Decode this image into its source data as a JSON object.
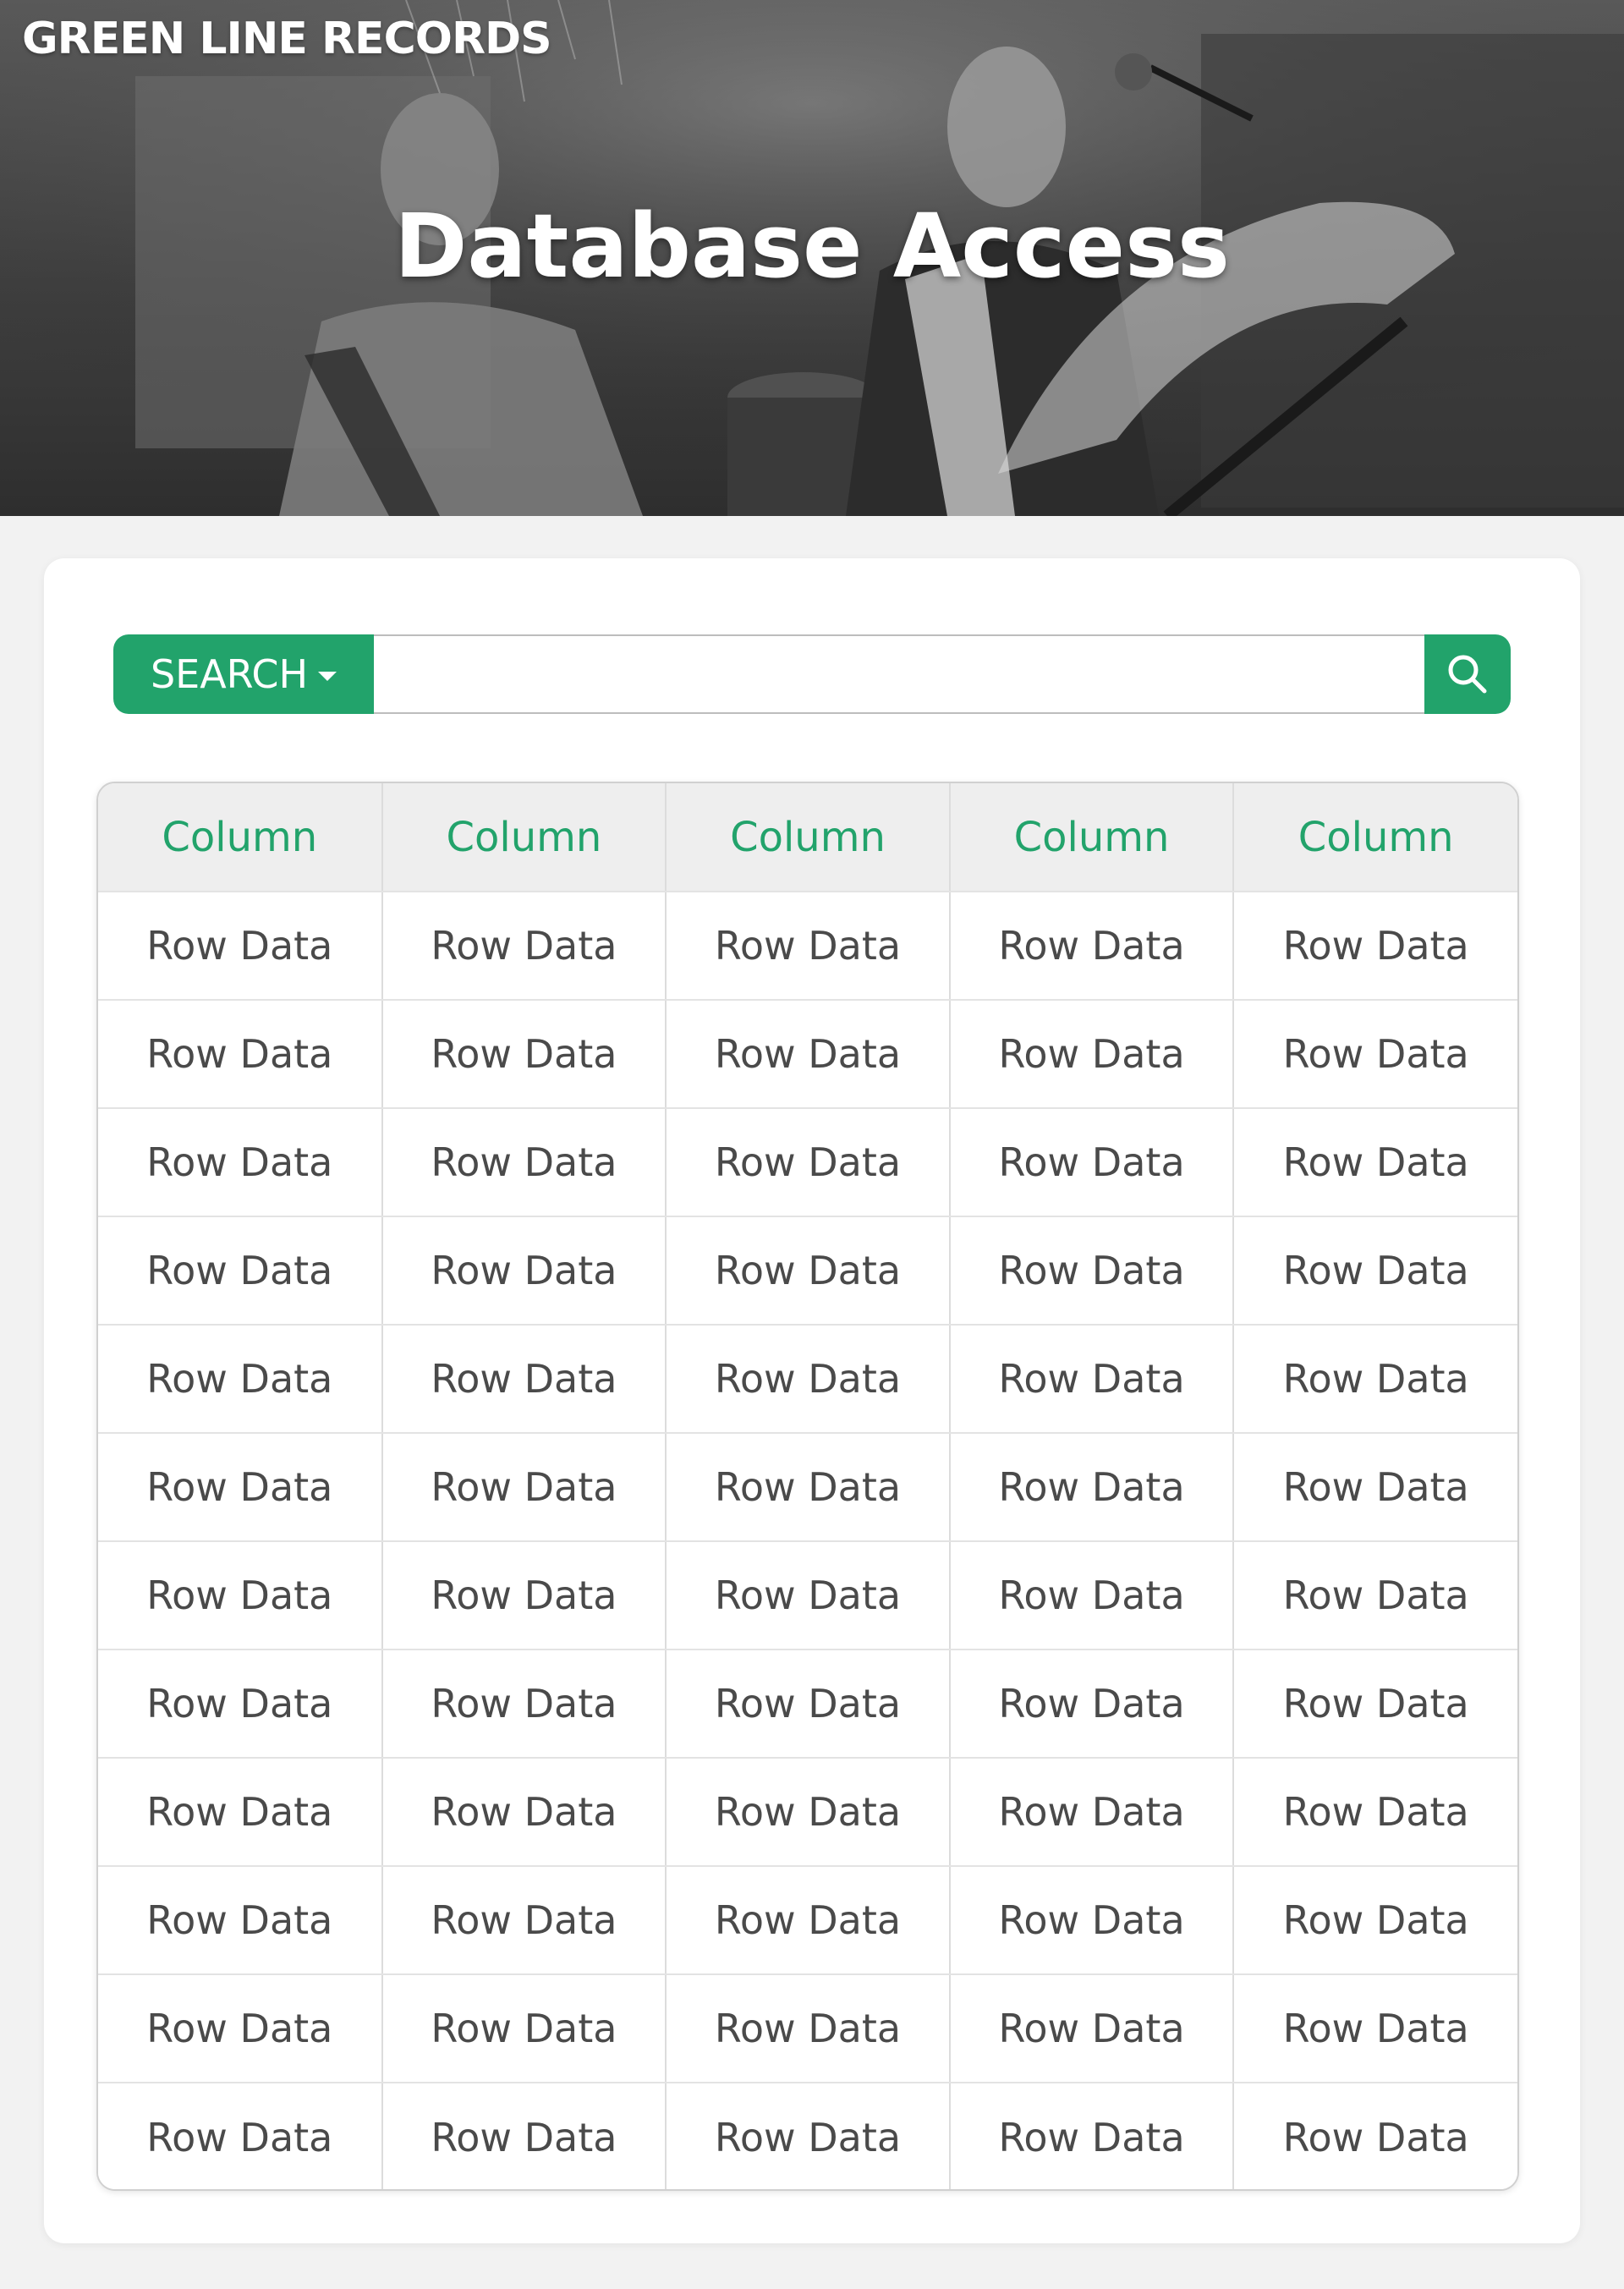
{
  "brand": {
    "name": "GREEN LINE RECORDS"
  },
  "hero": {
    "title": "Database Access"
  },
  "search": {
    "dropdown_label": "SEARCH",
    "placeholder": "",
    "value": "",
    "accent_color": "#22a36b",
    "submit_icon": "search-icon"
  },
  "table": {
    "columns": [
      "Column",
      "Column",
      "Column",
      "Column",
      "Column"
    ],
    "rows": [
      [
        "Row Data",
        "Row Data",
        "Row Data",
        "Row Data",
        "Row Data"
      ],
      [
        "Row Data",
        "Row Data",
        "Row Data",
        "Row Data",
        "Row Data"
      ],
      [
        "Row Data",
        "Row Data",
        "Row Data",
        "Row Data",
        "Row Data"
      ],
      [
        "Row Data",
        "Row Data",
        "Row Data",
        "Row Data",
        "Row Data"
      ],
      [
        "Row Data",
        "Row Data",
        "Row Data",
        "Row Data",
        "Row Data"
      ],
      [
        "Row Data",
        "Row Data",
        "Row Data",
        "Row Data",
        "Row Data"
      ],
      [
        "Row Data",
        "Row Data",
        "Row Data",
        "Row Data",
        "Row Data"
      ],
      [
        "Row Data",
        "Row Data",
        "Row Data",
        "Row Data",
        "Row Data"
      ],
      [
        "Row Data",
        "Row Data",
        "Row Data",
        "Row Data",
        "Row Data"
      ],
      [
        "Row Data",
        "Row Data",
        "Row Data",
        "Row Data",
        "Row Data"
      ],
      [
        "Row Data",
        "Row Data",
        "Row Data",
        "Row Data",
        "Row Data"
      ],
      [
        "Row Data",
        "Row Data",
        "Row Data",
        "Row Data",
        "Row Data"
      ]
    ]
  }
}
